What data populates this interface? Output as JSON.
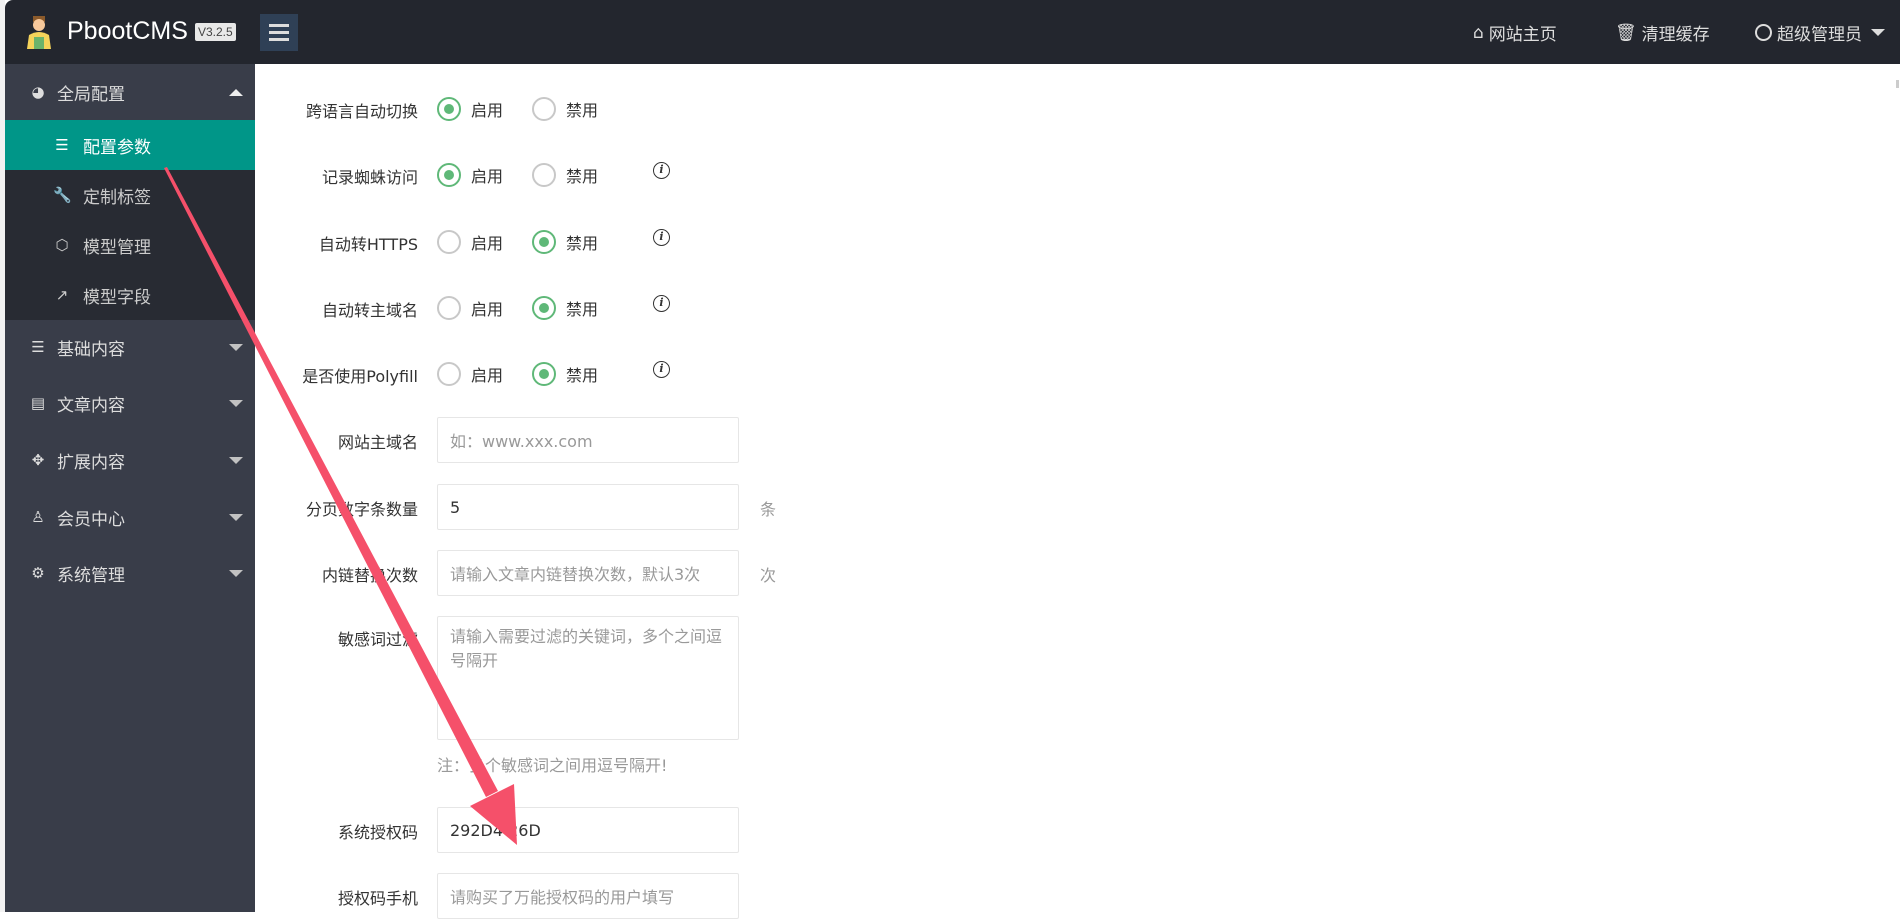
{
  "header": {
    "brand": "PbootCMS",
    "version": "V3.2.5",
    "nav": [
      {
        "icon": "home-icon",
        "label": "网站主页"
      },
      {
        "icon": "trash-icon",
        "label": "清理缓存"
      },
      {
        "icon": "user-circle-icon",
        "label": "超级管理员"
      }
    ]
  },
  "sidebar": {
    "groups": [
      {
        "icon": "globe-icon",
        "label": "全局配置",
        "expanded": true,
        "items": [
          {
            "icon": "sliders-icon",
            "label": "配置参数",
            "active": true
          },
          {
            "icon": "wrench-icon",
            "label": "定制标签"
          },
          {
            "icon": "codepen-icon",
            "label": "模型管理"
          },
          {
            "icon": "external-link-icon",
            "label": "模型字段"
          }
        ]
      },
      {
        "icon": "sliders-icon",
        "label": "基础内容"
      },
      {
        "icon": "file-text-icon",
        "label": "文章内容"
      },
      {
        "icon": "expand-icon",
        "label": "扩展内容"
      },
      {
        "icon": "user-icon",
        "label": "会员中心"
      },
      {
        "icon": "gear-icon",
        "label": "系统管理"
      }
    ]
  },
  "form": {
    "radio_on": "启用",
    "radio_off": "禁用",
    "radios": [
      {
        "label": "跨语言自动切换",
        "value": "启用",
        "info": false
      },
      {
        "label": "记录蜘蛛访问",
        "value": "启用",
        "info": true
      },
      {
        "label": "自动转HTTPS",
        "value": "禁用",
        "info": true
      },
      {
        "label": "自动转主域名",
        "value": "禁用",
        "info": true
      },
      {
        "label": "是否使用Polyfill",
        "value": "禁用",
        "info": true
      }
    ],
    "domain": {
      "label": "网站主域名",
      "value": "",
      "placeholder": "如：www.xxx.com"
    },
    "page_count": {
      "label": "分页数字条数量",
      "value": "5",
      "suffix": "条"
    },
    "link_replace": {
      "label": "内链替换次数",
      "value": "",
      "placeholder": "请输入文章内链替换次数，默认3次",
      "suffix": "次"
    },
    "sensitive": {
      "label": "敏感词过滤",
      "placeholder": "请输入需要过滤的关键词，多个之间逗号隔开",
      "note": "注：多个敏感词之间用逗号隔开!"
    },
    "license": {
      "label": "系统授权码",
      "value": "292D4  26D"
    },
    "license_phone": {
      "label": "授权码手机",
      "placeholder": "请购买了万能授权码的用户填写"
    }
  },
  "colors": {
    "header": "#23262e",
    "sidebar": "#393d49",
    "active": "#009688",
    "radio": "#5fb878",
    "arrow": "#f5506a"
  }
}
